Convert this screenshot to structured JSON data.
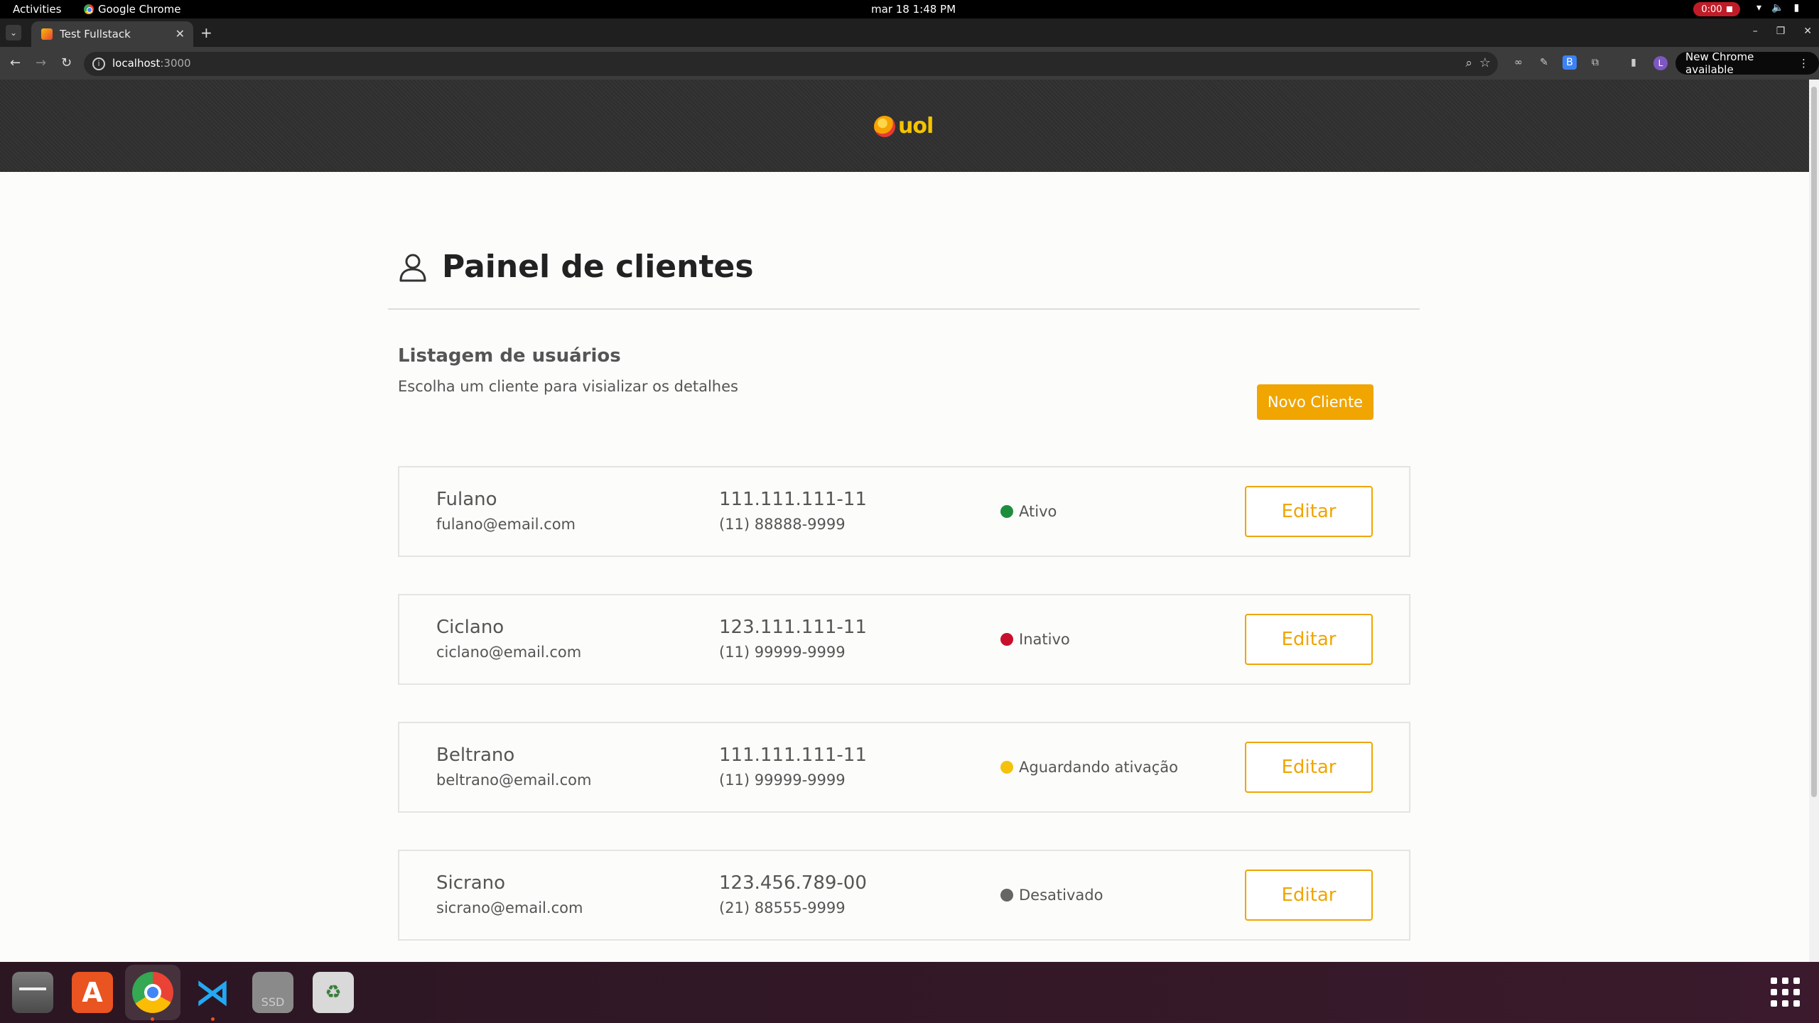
{
  "system": {
    "activities": "Activities",
    "app_name": "Google Chrome",
    "clock": "mar 18  1:48 PM",
    "recording": "0:00"
  },
  "browser": {
    "tab_title": "Test Fullstack",
    "url_host": "localhost",
    "url_port": ":3000",
    "new_chrome_label": "New Chrome available"
  },
  "site": {
    "logo_text": "uol",
    "page_title": "Painel de clientes",
    "list_title": "Listagem de usuários",
    "list_subtitle": "Escolha um cliente para visializar os detalhes",
    "new_client_label": "Novo Cliente",
    "edit_label": "Editar"
  },
  "clients": [
    {
      "name": "Fulano",
      "email": "fulano@email.com",
      "cpf": "111.111.111-11",
      "phone": "(11) 88888-9999",
      "status": "Ativo",
      "status_color": "#1e8e3e"
    },
    {
      "name": "Ciclano",
      "email": "ciclano@email.com",
      "cpf": "123.111.111-11",
      "phone": "(11) 99999-9999",
      "status": "Inativo",
      "status_color": "#c8102e"
    },
    {
      "name": "Beltrano",
      "email": "beltrano@email.com",
      "cpf": "111.111.111-11",
      "phone": "(11) 99999-9999",
      "status": "Aguardando ativação",
      "status_color": "#f4c20d"
    },
    {
      "name": "Sicrano",
      "email": "sicrano@email.com",
      "cpf": "123.456.789-00",
      "phone": "(21) 88555-9999",
      "status": "Desativado",
      "status_color": "#666666"
    }
  ],
  "colors": {
    "accent": "#f0a500",
    "header_bg": "#333333",
    "page_bg": "#fcfcfa"
  },
  "dock": {
    "ssd_label": "SSD"
  }
}
